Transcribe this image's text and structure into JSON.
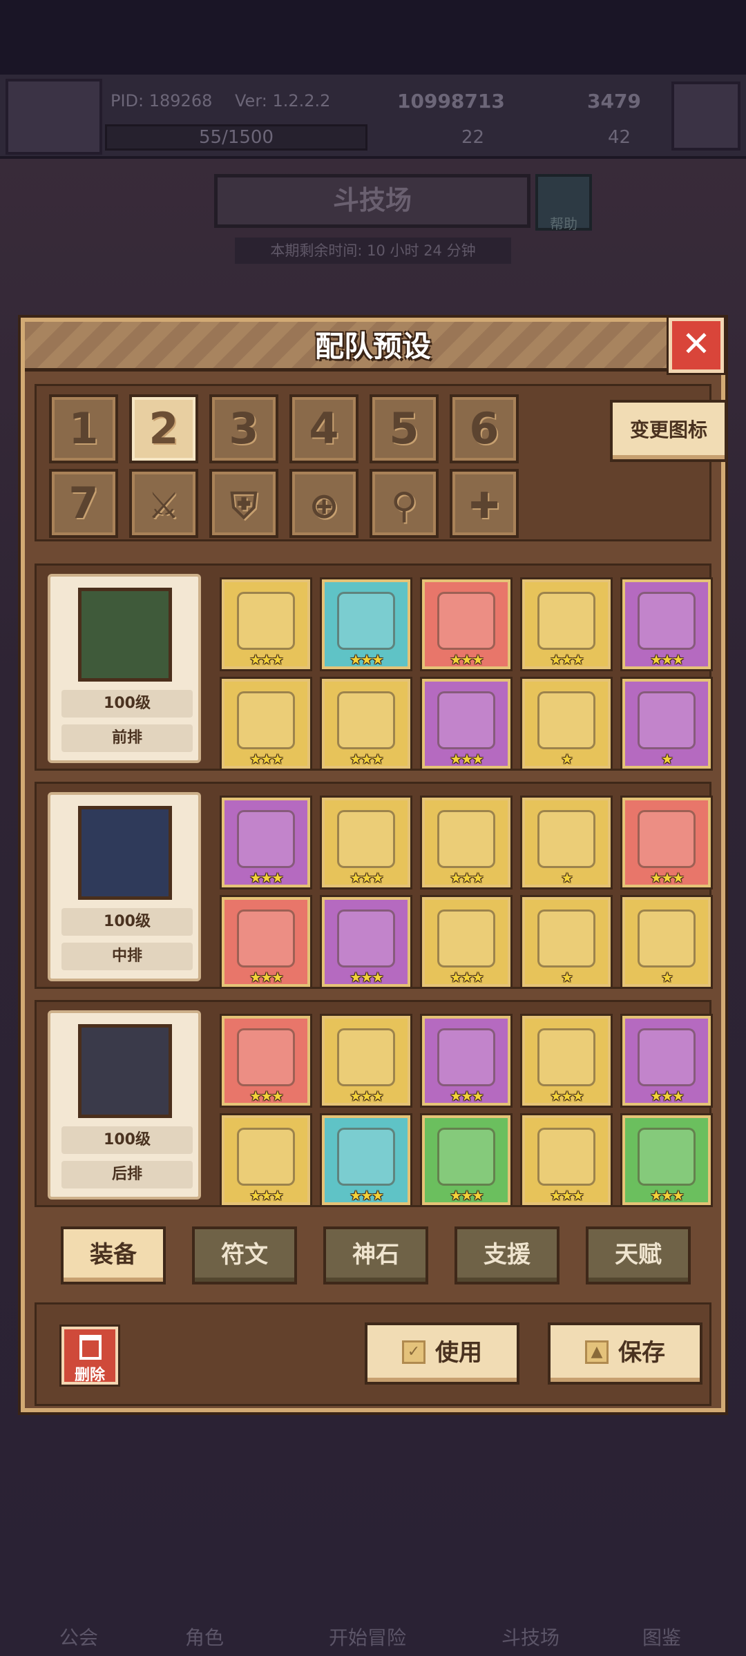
{
  "background": {
    "pid": "PID: 189268",
    "version": "Ver: 1.2.2.2",
    "gold": "10998713",
    "gems": "3479",
    "xp": "55/1500",
    "stat_a": "22",
    "stat_b": "42",
    "arena_title": "斗技场",
    "help_label": "帮助",
    "remaining_time": "本期剩余时间: 10 小时 24 分钟",
    "nav": [
      "公会",
      "角色",
      "开始冒险",
      "斗技场",
      "图鉴"
    ]
  },
  "modal": {
    "title": "配队预设",
    "close_icon": "close-icon",
    "slots": [
      "1",
      "2",
      "3",
      "4",
      "5",
      "6",
      "7"
    ],
    "active_slot": "2",
    "symbol_slots": [
      "sword-icon",
      "shield-icon",
      "crosshair-icon",
      "staff-icon",
      "cross-icon"
    ],
    "change_icon_label": "变更图标",
    "heroes": [
      {
        "level": "100级",
        "position": "前排",
        "equipment": [
          {
            "name": "flame-sword-icon",
            "bg": "#e7c35a",
            "stars": "★★★"
          },
          {
            "name": "shell-icon",
            "bg": "#5fc3c6",
            "stars": "★★★"
          },
          {
            "name": "necklace-icon",
            "bg": "#e8766a",
            "stars": "★★★"
          },
          {
            "name": "amulet-icon",
            "bg": "#e7c35a",
            "stars": "★★★"
          },
          {
            "name": "orb-pouch-icon",
            "bg": "#b56ac0",
            "stars": "★★★"
          },
          {
            "name": "helmet-icon",
            "bg": "#e7c35a",
            "stars": "★★★"
          },
          {
            "name": "armor-icon",
            "bg": "#e7c35a",
            "stars": "★★★"
          },
          {
            "name": "crystal-bone-icon",
            "bg": "#b56ac0",
            "stars": "★★★"
          },
          {
            "name": "ring-icon",
            "bg": "#e7c35a",
            "stars": "★"
          },
          {
            "name": "boots-icon",
            "bg": "#b56ac0",
            "stars": "★"
          }
        ]
      },
      {
        "level": "100级",
        "position": "中排",
        "equipment": [
          {
            "name": "magnifier-icon",
            "bg": "#b56ac0",
            "stars": "★★★"
          },
          {
            "name": "gem-shield-icon",
            "bg": "#e7c35a",
            "stars": "★★★"
          },
          {
            "name": "pendant-icon",
            "bg": "#e7c35a",
            "stars": "★★★"
          },
          {
            "name": "ice-orb-icon",
            "bg": "#e7c35a",
            "stars": "★"
          },
          {
            "name": "gold-ring-icon",
            "bg": "#e8766a",
            "stars": "★★★"
          },
          {
            "name": "straw-hat-icon",
            "bg": "#e8766a",
            "stars": "★★★"
          },
          {
            "name": "tunic-icon",
            "bg": "#b56ac0",
            "stars": "★★★"
          },
          {
            "name": "jeweled-gauntlet-icon",
            "bg": "#e7c35a",
            "stars": "★★★"
          },
          {
            "name": "crown-ring-icon",
            "bg": "#e7c35a",
            "stars": "★"
          },
          {
            "name": "ice-boots-icon",
            "bg": "#e7c35a",
            "stars": "★"
          }
        ]
      },
      {
        "level": "100级",
        "position": "后排",
        "equipment": [
          {
            "name": "wooden-staff-icon",
            "bg": "#e8766a",
            "stars": "★★★"
          },
          {
            "name": "crossed-swords-icon",
            "bg": "#e7c35a",
            "stars": "★★★"
          },
          {
            "name": "heart-necklace-icon",
            "bg": "#b56ac0",
            "stars": "★★★"
          },
          {
            "name": "jewel-brooch-icon",
            "bg": "#e7c35a",
            "stars": "★★★"
          },
          {
            "name": "tiara-ring-icon",
            "bg": "#b56ac0",
            "stars": "★★★"
          },
          {
            "name": "green-hat-icon",
            "bg": "#e7c35a",
            "stars": "★★★"
          },
          {
            "name": "chainmail-icon",
            "bg": "#5fc3c6",
            "stars": "★★★"
          },
          {
            "name": "scroll-icon",
            "bg": "#6bbf5e",
            "stars": "★★★"
          },
          {
            "name": "belt-icon",
            "bg": "#e7c35a",
            "stars": "★★★"
          },
          {
            "name": "leather-boots-icon",
            "bg": "#6bbf5e",
            "stars": "★★★"
          }
        ]
      }
    ],
    "tabs": [
      "装备",
      "符文",
      "神石",
      "支援",
      "天赋"
    ],
    "active_tab": "装备",
    "delete_label": "删除",
    "use_label": "使用",
    "save_label": "保存"
  }
}
